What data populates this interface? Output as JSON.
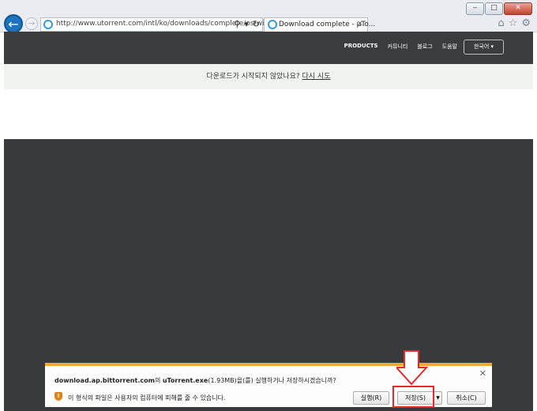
{
  "browser": {
    "url": "http://www.utorrent.com/intl/ko/downloads/complete/os/win/",
    "tab_title": "Download complete - μTo...",
    "window_controls": [
      "minimize",
      "restore",
      "close"
    ],
    "icons": [
      "back-icon",
      "forward-icon",
      "search-icon",
      "dropdown-icon",
      "refresh-icon",
      "home-icon",
      "favorites-star-icon",
      "settings-gear-icon"
    ]
  },
  "nav": {
    "items": [
      "PRODUCTS",
      "커뮤니티",
      "블로그",
      "도움말"
    ],
    "language": "한국어"
  },
  "notice": {
    "text": "다운로드가 시작되지 않았나요?",
    "link": "다시 시도"
  },
  "download_bar": {
    "filename_host": "download.ap.bittorrent.com",
    "part1": "의 ",
    "file": "uTorrent.exe",
    "part2": "(1.93MB)을(를) 실행하거나 저장하시겠습니까?",
    "warning": "이 형식의 파일은 사용자의 컴퓨터에 피해를 줄 수 있습니다.",
    "run": "실행(R)",
    "save": "저장(S)",
    "cancel": "취소(C)"
  },
  "colors": {
    "nav_bg": "#3b3c3e",
    "notification_accent": "#efa92e",
    "highlight": "#e8282a",
    "ie_blue": "#1e73be"
  }
}
